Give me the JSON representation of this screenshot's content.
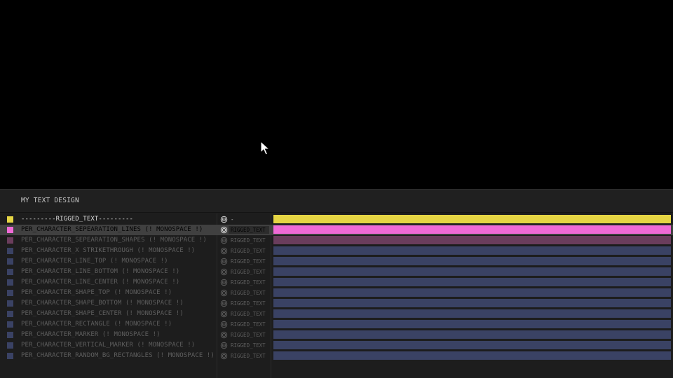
{
  "composition": {
    "title": "MY TEXT DESIGN"
  },
  "colors": {
    "null_label": "#e5d544",
    "pink_label": "#f06ad6",
    "pink_dim": "#6a3d5c",
    "blue_dim": "#3a4264"
  },
  "layers": [
    {
      "name": "---------RIGGED_TEXT---------",
      "parent": "-",
      "label_color": "#e5d544",
      "bar_color": "#e5d544",
      "state": "bright"
    },
    {
      "name": "PER_CHARACTER_SEPEARATION_LINES (! MONOSPACE !)",
      "parent": "RIGGED_TEXT",
      "label_color": "#f06ad6",
      "bar_color": "#f06ad6",
      "state": "selected"
    },
    {
      "name": "PER_CHARACTER_SEPEARATION_SHAPES (! MONOSPACE !)",
      "parent": "RIGGED_TEXT",
      "label_color": "#6a3d5c",
      "bar_color": "#6a3d5c",
      "state": "dim"
    },
    {
      "name": "PER_CHARACTER_X STRIKETHROUGH (! MONOSPACE !)",
      "parent": "RIGGED_TEXT",
      "label_color": "#3a4264",
      "bar_color": "#3a4264",
      "state": "dim"
    },
    {
      "name": "PER_CHARACTER_LINE_TOP (! MONOSPACE !)",
      "parent": "RIGGED_TEXT",
      "label_color": "#3a4264",
      "bar_color": "#3a4264",
      "state": "dim"
    },
    {
      "name": "PER_CHARACTER_LINE_BOTTOM (! MONOSPACE !)",
      "parent": "RIGGED_TEXT",
      "label_color": "#3a4264",
      "bar_color": "#3a4264",
      "state": "dim"
    },
    {
      "name": "PER_CHARACTER_LINE_CENTER (! MONOSPACE !)",
      "parent": "RIGGED_TEXT",
      "label_color": "#3a4264",
      "bar_color": "#3a4264",
      "state": "dim"
    },
    {
      "name": "PER_CHARACTER_SHAPE_TOP (! MONOSPACE !)",
      "parent": "RIGGED_TEXT",
      "label_color": "#3a4264",
      "bar_color": "#3a4264",
      "state": "dim"
    },
    {
      "name": "PER_CHARACTER_SHAPE_BOTTOM (! MONOSPACE !)",
      "parent": "RIGGED_TEXT",
      "label_color": "#3a4264",
      "bar_color": "#3a4264",
      "state": "dim"
    },
    {
      "name": "PER_CHARACTER_SHAPE_CENTER (! MONOSPACE !)",
      "parent": "RIGGED_TEXT",
      "label_color": "#3a4264",
      "bar_color": "#3a4264",
      "state": "dim"
    },
    {
      "name": "PER_CHARACTER_RECTANGLE (! MONOSPACE !)",
      "parent": "RIGGED_TEXT",
      "label_color": "#3a4264",
      "bar_color": "#3a4264",
      "state": "dim"
    },
    {
      "name": "PER_CHARACTER_MARKER (! MONOSPACE !)",
      "parent": "RIGGED_TEXT",
      "label_color": "#3a4264",
      "bar_color": "#3a4264",
      "state": "dim"
    },
    {
      "name": "PER_CHARACTER_VERTICAL_MARKER (! MONOSPACE !)",
      "parent": "RIGGED_TEXT",
      "label_color": "#3a4264",
      "bar_color": "#3a4264",
      "state": "dim"
    },
    {
      "name": "PER_CHARACTER_RANDOM_BG_RECTANGLES (! MONOSPACE !)",
      "parent": "RIGGED_TEXT",
      "label_color": "#3a4264",
      "bar_color": "#3a4264",
      "state": "dim"
    }
  ]
}
